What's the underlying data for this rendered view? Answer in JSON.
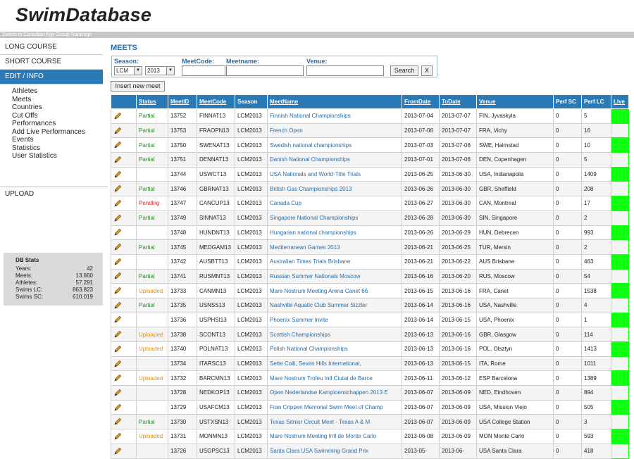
{
  "header": {
    "logo": "SwimDatabase",
    "switch_link": "Switch to Canadian Age Group Rankings"
  },
  "sidebar": {
    "items": [
      {
        "label": "LONG COURSE",
        "active": false
      },
      {
        "label": "SHORT COURSE",
        "active": false
      },
      {
        "label": "EDIT / INFO",
        "active": true
      }
    ],
    "subitems": [
      "Athletes",
      "Meets",
      "Countries",
      "Cut Offs",
      "Performances",
      "Add Live Performances",
      "Events",
      "Statistics",
      "User Statistics"
    ],
    "upload": "UPLOAD"
  },
  "db_stats": {
    "title": "DB Stats",
    "rows": [
      {
        "label": "Years:",
        "value": "42"
      },
      {
        "label": "Meets:",
        "value": "13.660"
      },
      {
        "label": "Athletes:",
        "value": "57.291"
      },
      {
        "label": "Swims LC:",
        "value": "863.823"
      },
      {
        "label": "Swims SC:",
        "value": "610.019"
      }
    ]
  },
  "main": {
    "title": "MEETS",
    "filters": {
      "season_label": "Season:",
      "course_value": "LCM",
      "year_value": "2013",
      "meetcode_label": "MeetCode:",
      "meetname_label": "Meetname:",
      "venue_label": "Venue:",
      "search_label": "Search",
      "clear_label": "X"
    },
    "insert_label": "Insert new meet"
  },
  "table": {
    "columns": [
      "",
      "Status",
      "MeetID",
      "MeetCode",
      "Season",
      "MeetName",
      "FromDate",
      "ToDate",
      "Venue",
      "Perf SC",
      "Perf LC",
      "Live"
    ],
    "rows": [
      {
        "status": "Partial",
        "id": "13752",
        "code": "FINNAT13",
        "season": "LCM2013",
        "name": "Finnish National Championships",
        "from": "2013-07-04",
        "to": "2013-07-07",
        "venue": "FIN, Jyvaskyla",
        "sc": "0",
        "lc": "5"
      },
      {
        "status": "Partial",
        "id": "13753",
        "code": "FRAOPN13",
        "season": "LCM2013",
        "name": "French Open",
        "from": "2013-07-06",
        "to": "2013-07-07",
        "venue": "FRA, Vichy",
        "sc": "0",
        "lc": "16"
      },
      {
        "status": "Partial",
        "id": "13750",
        "code": "SWENAT13",
        "season": "LCM2013",
        "name": "Swedish national championships",
        "from": "2013-07-03",
        "to": "2013-07-06",
        "venue": "SWE, Halmstad",
        "sc": "0",
        "lc": "10"
      },
      {
        "status": "Partial",
        "id": "13751",
        "code": "DENNAT13",
        "season": "LCM2013",
        "name": "Danish National Championships",
        "from": "2013-07-01",
        "to": "2013-07-06",
        "venue": "DEN, Copenhagen",
        "sc": "0",
        "lc": "5"
      },
      {
        "status": "",
        "id": "13744",
        "code": "USWCT13",
        "season": "LCM2013",
        "name": "USA Nationals and World-Title Trials",
        "from": "2013-06-25",
        "to": "2013-06-30",
        "venue": "USA, Indianapolis",
        "sc": "0",
        "lc": "1409"
      },
      {
        "status": "Partial",
        "id": "13746",
        "code": "GBRNAT13",
        "season": "LCM2013",
        "name": "British Gas Championships 2013",
        "from": "2013-06-26",
        "to": "2013-06-30",
        "venue": "GBR, Sheffield",
        "sc": "0",
        "lc": "208"
      },
      {
        "status": "Pending",
        "id": "13747",
        "code": "CANCUP13",
        "season": "LCM2013",
        "name": "Canada Cup",
        "from": "2013-06-27",
        "to": "2013-06-30",
        "venue": "CAN, Montreal",
        "sc": "0",
        "lc": "17"
      },
      {
        "status": "Partial",
        "id": "13749",
        "code": "SINNAT13",
        "season": "LCM2013",
        "name": "Singapore National Championships",
        "from": "2013-06-28",
        "to": "2013-06-30",
        "venue": "SIN, Singapore",
        "sc": "0",
        "lc": "2"
      },
      {
        "status": "",
        "id": "13748",
        "code": "HUNDNT13",
        "season": "LCM2013",
        "name": "Hungarian national championships",
        "from": "2013-06-26",
        "to": "2013-06-29",
        "venue": "HUN, Debrecen",
        "sc": "0",
        "lc": "993"
      },
      {
        "status": "Partial",
        "id": "13745",
        "code": "MEDGAM13",
        "season": "LCM2013",
        "name": "Mediterranean Games 2013",
        "from": "2013-06-21",
        "to": "2013-06-25",
        "venue": "TUR, Mersin",
        "sc": "0",
        "lc": "2"
      },
      {
        "status": "",
        "id": "13742",
        "code": "AUSBTT13",
        "season": "LCM2013",
        "name": "Australian Times Trials Brisbane",
        "from": "2013-06-21",
        "to": "2013-06-22",
        "venue": "AUS Brisbane",
        "sc": "0",
        "lc": "463"
      },
      {
        "status": "Partial",
        "id": "13741",
        "code": "RUSMNT13",
        "season": "LCM2013",
        "name": "Russian Summer Nationals Moscow",
        "from": "2013-06-16",
        "to": "2013-06-20",
        "venue": "RUS, Moscow",
        "sc": "0",
        "lc": "54"
      },
      {
        "status": "Uploaded",
        "id": "13733",
        "code": "CANMN13",
        "season": "LCM2013",
        "name": "Mare Nostrum Meeting Arena Canet 66",
        "from": "2013-06-15",
        "to": "2013-06-16",
        "venue": "FRA, Canet",
        "sc": "0",
        "lc": "1538"
      },
      {
        "status": "Partial",
        "id": "13735",
        "code": "USNSS13",
        "season": "LCM2013",
        "name": "Nashville Aquatic Club Summer Sizzler",
        "from": "2013-06-14",
        "to": "2013-06-16",
        "venue": "USA, Nashville",
        "sc": "0",
        "lc": "4"
      },
      {
        "status": "",
        "id": "13736",
        "code": "USPHSI13",
        "season": "LCM2013",
        "name": "Phoenix Summer Invite",
        "from": "2013-06-14",
        "to": "2013-06-15",
        "venue": "USA, Phoenix",
        "sc": "0",
        "lc": "1"
      },
      {
        "status": "Uploaded",
        "id": "13738",
        "code": "SCONT13",
        "season": "LCM2013",
        "name": "Scottish Championships",
        "from": "2013-06-13",
        "to": "2013-06-16",
        "venue": "GBR, Glasgow",
        "sc": "0",
        "lc": "114"
      },
      {
        "status": "Uploaded",
        "id": "13740",
        "code": "POLNAT13",
        "season": "LCM2013",
        "name": "Polish National Championships",
        "from": "2013-06-13",
        "to": "2013-06-16",
        "venue": "POL, Olsztyn",
        "sc": "0",
        "lc": "1413"
      },
      {
        "status": "",
        "id": "13734",
        "code": "ITARSC13",
        "season": "LCM2013",
        "name": "Sette Colli, Seven Hills International,",
        "from": "2013-06-13",
        "to": "2013-06-15",
        "venue": "ITA, Rome",
        "sc": "0",
        "lc": "1011"
      },
      {
        "status": "Uploaded",
        "id": "13732",
        "code": "BARCMN13",
        "season": "LCM2013",
        "name": "Mare Nostrum Trofeu Intl Ciutat de Barce",
        "from": "2013-06-11",
        "to": "2013-06-12",
        "venue": "ESP Barcelona",
        "sc": "0",
        "lc": "1389"
      },
      {
        "status": "",
        "id": "13728",
        "code": "NEDKOP13",
        "season": "LCM2013",
        "name": "Open Nederlandse Kampioenschappen 2013 E",
        "from": "2013-06-07",
        "to": "2013-06-09",
        "venue": "NED, Eindhoven",
        "sc": "0",
        "lc": "894"
      },
      {
        "status": "",
        "id": "13729",
        "code": "USAFCM13",
        "season": "LCM2013",
        "name": "Fran Crippen Memorial Swim Meet of Champ",
        "from": "2013-06-07",
        "to": "2013-06-09",
        "venue": "USA, Mission Viejo",
        "sc": "0",
        "lc": "505"
      },
      {
        "status": "Partial",
        "id": "13730",
        "code": "USTXSN13",
        "season": "LCM2013",
        "name": "Texas Senior Circuit Meet - Texas A & M",
        "from": "2013-06-07",
        "to": "2013-06-09",
        "venue": "USA College Station",
        "sc": "0",
        "lc": "3"
      },
      {
        "status": "Uploaded",
        "id": "13731",
        "code": "MONMN13",
        "season": "LCM2013",
        "name": "Mare Nostrum Meeting Intl de Monte Carlo",
        "from": "2013-06-08",
        "to": "2013-06-09",
        "venue": "MON Monte Carlo",
        "sc": "0",
        "lc": "593"
      },
      {
        "status": "",
        "id": "13726",
        "code": "USGPSC13",
        "season": "LCM2013",
        "name": "Santa Clara USA Swimming Grand Prix",
        "from": "2013-05-",
        "to": "2013-06-",
        "venue": "USA Santa Clara",
        "sc": "0",
        "lc": "418"
      }
    ]
  },
  "colors": {
    "header_blue": "#2a7ab8",
    "live_green": "#11ff11",
    "partial": "#2e8b2e",
    "pending": "#e02020",
    "uploaded": "#f08c00"
  }
}
